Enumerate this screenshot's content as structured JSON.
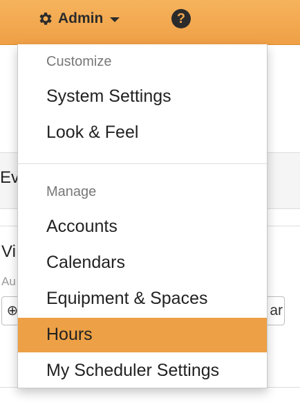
{
  "navbar": {
    "admin_label": "Admin",
    "admin_icon": "gear-icon",
    "help_icon": "question-circle-icon",
    "help_glyph": "?",
    "color": "#f3a84f"
  },
  "background_page": {
    "tab_partial": "Ev",
    "heading_partial": "Vi",
    "subtext_partial": "Au",
    "left_button_glyph": "⊕",
    "right_button_partial": "ar"
  },
  "menu": {
    "sections": [
      {
        "header": "Customize",
        "items": [
          {
            "label": "System Settings"
          },
          {
            "label": "Look & Feel"
          }
        ]
      },
      {
        "header": "Manage",
        "items": [
          {
            "label": "Accounts"
          },
          {
            "label": "Calendars"
          },
          {
            "label": "Equipment & Spaces"
          },
          {
            "label": "Hours",
            "active": true
          },
          {
            "label": "My Scheduler Settings"
          }
        ]
      }
    ],
    "active_color": "#eda045"
  }
}
